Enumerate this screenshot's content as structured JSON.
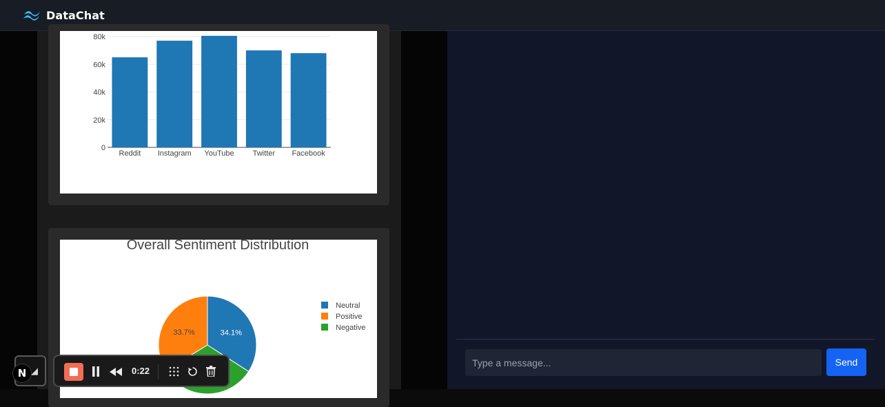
{
  "app": {
    "name": "DataChat"
  },
  "chat": {
    "placeholder": "Type a message...",
    "send_label": "Send"
  },
  "recorder": {
    "time": "0:22"
  },
  "colors": {
    "bar": "#1f77b4",
    "neutral": "#1f77b4",
    "positive": "#ff7f0e",
    "negative": "#2ca02c",
    "send": "#1463f3"
  },
  "icons": [
    "datachat-logo-icon",
    "next-logo-icon",
    "stop-icon",
    "pause-icon",
    "rewind-icon",
    "grid-icon",
    "restart-icon",
    "trash-icon"
  ],
  "chart_data": [
    {
      "type": "bar",
      "categories": [
        "Reddit",
        "Instagram",
        "YouTube",
        "Twitter",
        "Facebook"
      ],
      "values": [
        65000,
        77000,
        80500,
        70000,
        68000
      ],
      "ylim": [
        0,
        84000
      ],
      "yticks": [
        "0",
        "20k",
        "40k",
        "60k",
        "80k"
      ],
      "grid": true
    },
    {
      "type": "pie",
      "title": "Overall Sentiment Distribution",
      "labels": [
        "Neutral",
        "Positive",
        "Negative"
      ],
      "values": [
        34.1,
        33.7,
        32.2
      ],
      "data_labels": [
        "34.1%",
        "33.7%",
        ""
      ],
      "legend": "right"
    }
  ]
}
